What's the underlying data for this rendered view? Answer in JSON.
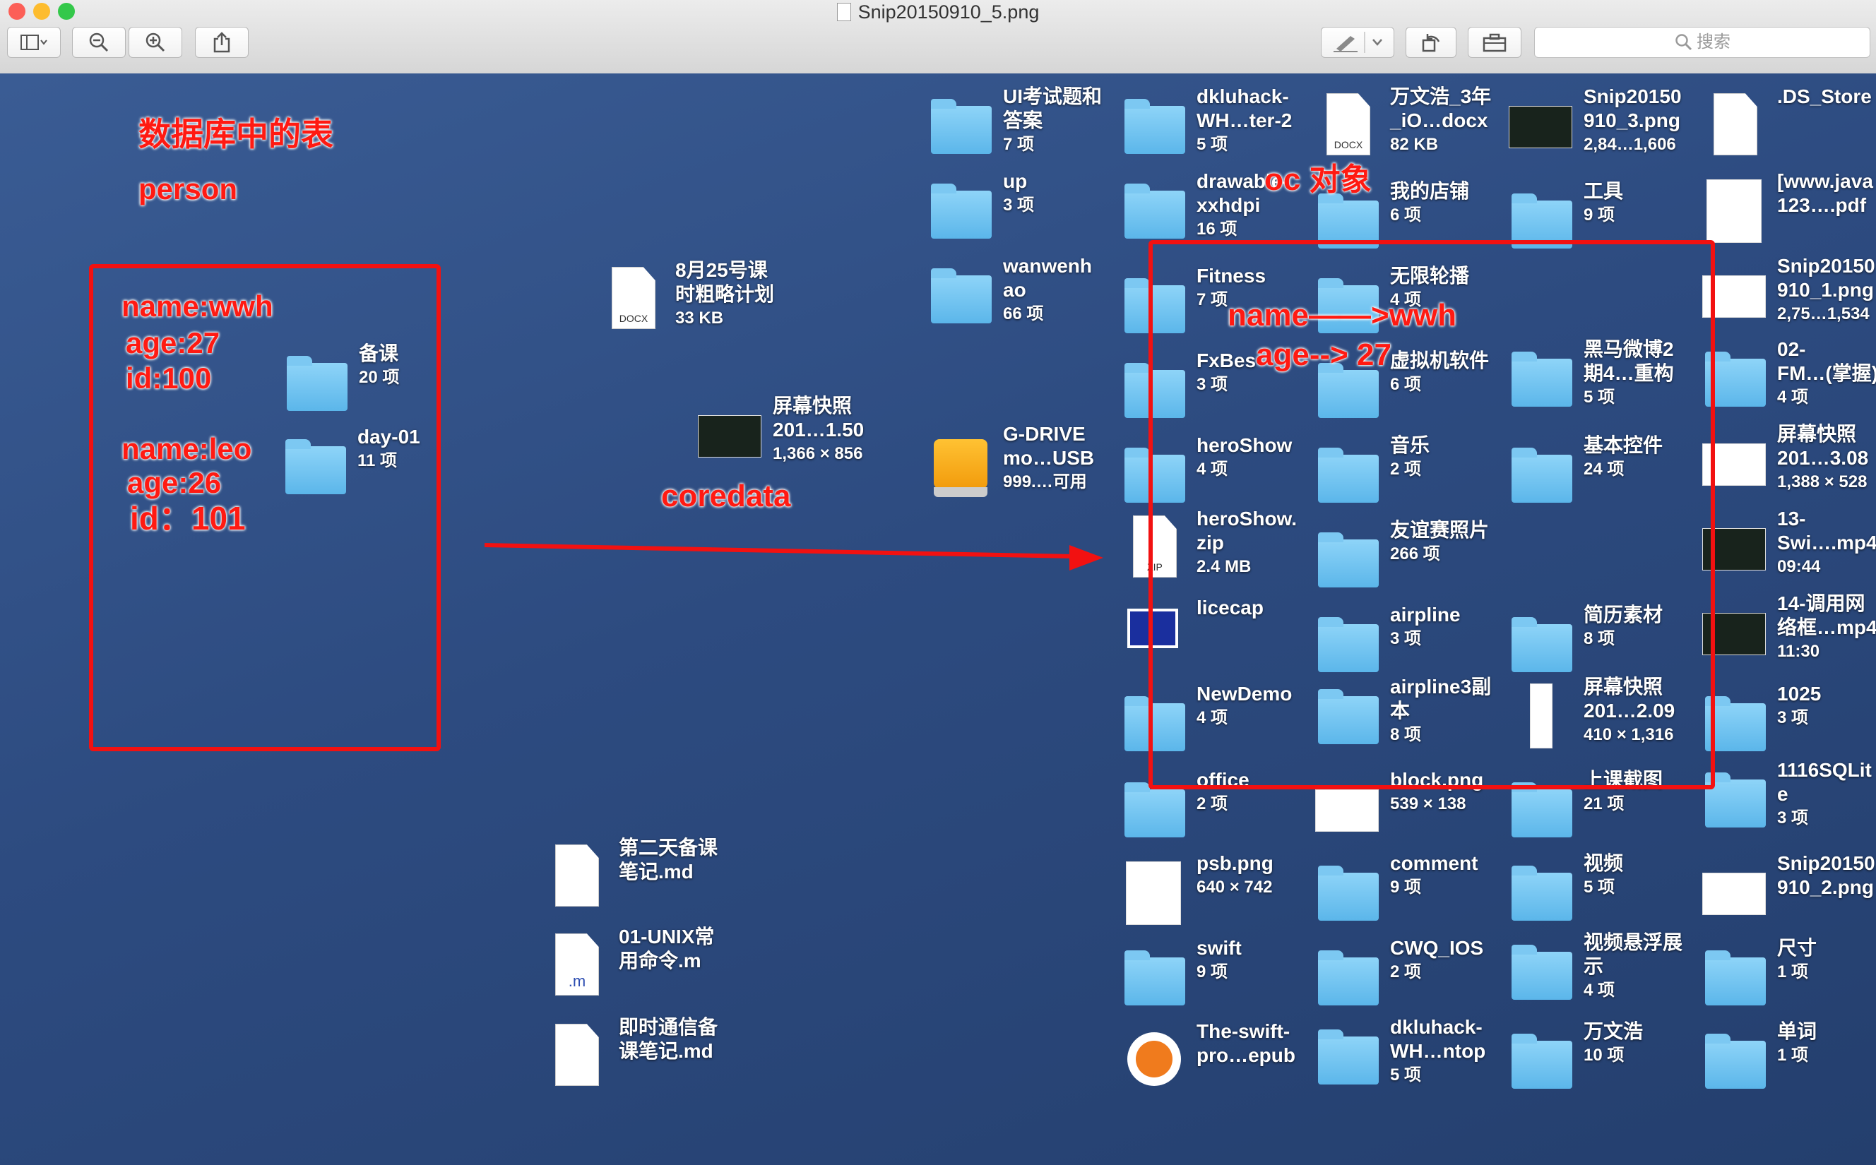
{
  "window": {
    "title": "Snip20150910_5.png",
    "search_placeholder": "搜索",
    "toolbar_icons": [
      "sidebar-icon",
      "zoom-out-icon",
      "zoom-in-icon",
      "share-icon",
      "pen-icon",
      "chevron-down-icon",
      "rotate-icon",
      "toolbox-icon"
    ]
  },
  "annotations": {
    "table_heading": "数据库中的表",
    "table_name": "person",
    "record1_name": "name:wwh",
    "record1_age": "age:27",
    "record1_id": "id:100",
    "record2_name": "name:leo",
    "record2_age": "age:26",
    "record2_id": "id：101",
    "coredata": "coredata",
    "oc_object": "oc 对象",
    "mapping_name": "name——>wwh",
    "mapping_age": "age--> 27"
  },
  "desktop_items": [
    {
      "id": "beike",
      "icon": "folder",
      "line1": "备课",
      "line2": "20 项"
    },
    {
      "id": "day01",
      "icon": "folder",
      "line1": "day-01",
      "line2": "11 项"
    },
    {
      "id": "plan",
      "icon": "docx",
      "line1": "8月25号课\n时粗略计划",
      "line2": "33 KB"
    },
    {
      "id": "snap1",
      "icon": "thumb-dark",
      "line1": "屏幕快照\n201…1.50",
      "line2": "1,366 × 856"
    },
    {
      "id": "note2",
      "icon": "doc",
      "line1": "第二天备课\n笔记.md",
      "line2": ""
    },
    {
      "id": "unix",
      "icon": "m",
      "line1": "01-UNIX常\n用命令.m",
      "line2": ""
    },
    {
      "id": "im",
      "icon": "doc",
      "line1": "即时通信备\n课笔记.md",
      "line2": ""
    },
    {
      "id": "ui",
      "icon": "folder",
      "line1": "UI考试题和\n答案",
      "line2": "7 项"
    },
    {
      "id": "up",
      "icon": "folder",
      "line1": "up",
      "line2": "3 项"
    },
    {
      "id": "wanwen",
      "icon": "folder",
      "line1": "wanwenh\nao",
      "line2": "66 项"
    },
    {
      "id": "gdrive",
      "icon": "drive",
      "line1": "G-DRIVE\nmo…USB",
      "line2": "999.…可用"
    },
    {
      "id": "dkwh",
      "icon": "folder",
      "line1": "dkluhack-\nWH…ter-2",
      "line2": "5 项"
    },
    {
      "id": "drawable",
      "icon": "folder",
      "line1": "drawable-\nxxhdpi",
      "line2": "16 项"
    },
    {
      "id": "fitness",
      "icon": "folder",
      "line1": "Fitness",
      "line2": "7 项"
    },
    {
      "id": "fxbes",
      "icon": "folder",
      "line1": "FxBes",
      "line2": "3 项"
    },
    {
      "id": "heroshow",
      "icon": "folder",
      "line1": "heroShow",
      "line2": "4 项"
    },
    {
      "id": "herozip",
      "icon": "zip",
      "line1": "heroShow.\nzip",
      "line2": "2.4 MB"
    },
    {
      "id": "licecap",
      "icon": "licecap",
      "line1": "licecap",
      "line2": ""
    },
    {
      "id": "newdemo",
      "icon": "folder",
      "line1": "NewDemo",
      "line2": "4 项"
    },
    {
      "id": "office",
      "icon": "folder",
      "line1": "office",
      "line2": "2 项"
    },
    {
      "id": "psb",
      "icon": "thumb-sq",
      "line1": "psb.png",
      "line2": "640 × 742"
    },
    {
      "id": "swift",
      "icon": "folder",
      "line1": "swift",
      "line2": "9 项"
    },
    {
      "id": "epub",
      "icon": "epub",
      "line1": "The-swift-\npro…epub",
      "line2": ""
    },
    {
      "id": "wanwenhao3",
      "icon": "docx",
      "line1": "万文浩_3年\n_iO…docx",
      "line2": "82 KB"
    },
    {
      "id": "shop",
      "icon": "folder",
      "line1": "我的店铺",
      "line2": "6 项"
    },
    {
      "id": "lunbo",
      "icon": "folder",
      "line1": "无限轮播",
      "line2": "4 项"
    },
    {
      "id": "vm",
      "icon": "folder",
      "line1": "虚拟机软件",
      "line2": "6 项"
    },
    {
      "id": "music",
      "icon": "folder",
      "line1": "音乐",
      "line2": "2 项"
    },
    {
      "id": "friend",
      "icon": "folder",
      "line1": "友谊赛照片",
      "line2": "266 项"
    },
    {
      "id": "airline",
      "icon": "folder",
      "line1": "airpline",
      "line2": "3 项"
    },
    {
      "id": "airline3",
      "icon": "folder",
      "line1": "airpline3副\n本",
      "line2": "8 项"
    },
    {
      "id": "block",
      "icon": "thumb",
      "line1": "block.png",
      "line2": "539 × 138"
    },
    {
      "id": "comment",
      "icon": "folder",
      "line1": "comment",
      "line2": "9 项"
    },
    {
      "id": "cwq",
      "icon": "folder",
      "line1": "CWQ_IOS",
      "line2": "2 项"
    },
    {
      "id": "dknt",
      "icon": "folder",
      "line1": "dkluhack-\nWH…ntop",
      "line2": "5 项"
    },
    {
      "id": "snip3",
      "icon": "thumb-dark",
      "line1": "Snip20150\n910_3.png",
      "line2": "2,84…1,606"
    },
    {
      "id": "tools",
      "icon": "folder",
      "line1": "工具",
      "line2": "9 项"
    },
    {
      "id": "heima",
      "icon": "folder",
      "line1": "黑马微博2\n期4…重构",
      "line2": "5 项"
    },
    {
      "id": "basic",
      "icon": "folder",
      "line1": "基本控件",
      "line2": "24 项"
    },
    {
      "id": "resume",
      "icon": "folder",
      "line1": "简历素材",
      "line2": "8 项"
    },
    {
      "id": "snap2",
      "icon": "thumb-tall",
      "line1": "屏幕快照\n201…2.09",
      "line2": "410 × 1,316"
    },
    {
      "id": "shot",
      "icon": "folder",
      "line1": "上课截图",
      "line2": "21 项"
    },
    {
      "id": "video",
      "icon": "folder",
      "line1": "视频",
      "line2": "5 项"
    },
    {
      "id": "float",
      "icon": "folder",
      "line1": "视频悬浮展\n示",
      "line2": "4 项"
    },
    {
      "id": "wwh",
      "icon": "folder",
      "line1": "万文浩",
      "line2": "10 项"
    },
    {
      "id": "ds",
      "icon": "doc",
      "line1": ".DS_Store",
      "line2": ""
    },
    {
      "id": "java",
      "icon": "thumb-sq",
      "line1": "[www.java\n123….pdf",
      "line2": ""
    },
    {
      "id": "snip1",
      "icon": "thumb",
      "line1": "Snip20150\n910_1.png",
      "line2": "2,75…1,534"
    },
    {
      "id": "fm",
      "icon": "folder",
      "line1": "02-\nFM…(掌握)",
      "line2": "4 项"
    },
    {
      "id": "snap3",
      "icon": "thumb",
      "line1": "屏幕快照\n201…3.08",
      "line2": "1,388 × 528"
    },
    {
      "id": "swi13",
      "icon": "thumb-dark",
      "line1": "13-\nSwi….mp4",
      "line2": "09:44"
    },
    {
      "id": "net14",
      "icon": "thumb-dark",
      "line1": "14-调用网\n络框…mp4",
      "line2": "11:30"
    },
    {
      "id": "f1025",
      "icon": "folder",
      "line1": "1025",
      "line2": "3 项"
    },
    {
      "id": "sqlite",
      "icon": "folder",
      "line1": "1116SQLit\ne",
      "line2": "3 项"
    },
    {
      "id": "snip2",
      "icon": "thumb",
      "line1": "Snip20150\n910_2.png",
      "line2": ""
    },
    {
      "id": "size",
      "icon": "folder",
      "line1": "尺寸",
      "line2": "1 项"
    },
    {
      "id": "word",
      "icon": "folder",
      "line1": "单词",
      "line2": "1 项"
    }
  ]
}
